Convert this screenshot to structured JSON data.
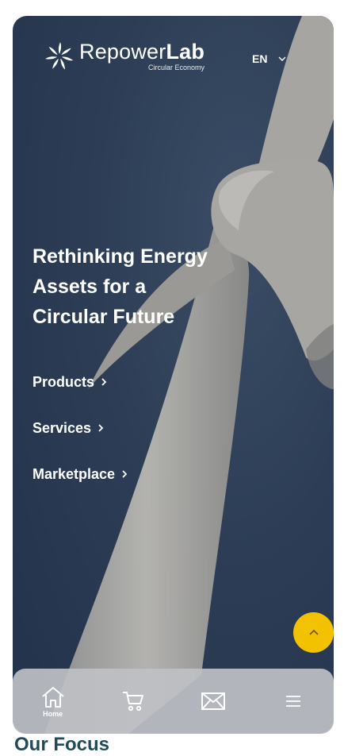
{
  "brand": {
    "name_light": "Repower",
    "name_bold": "Lab",
    "tagline": "Circular Economy"
  },
  "language": {
    "selected": "EN"
  },
  "hero": {
    "headline": "Rethinking Energy Assets for a Circular Future"
  },
  "links": [
    {
      "label": "Products"
    },
    {
      "label": "Services"
    },
    {
      "label": "Marketplace"
    }
  ],
  "tabs": [
    {
      "label": "Home",
      "icon": "home-icon"
    },
    {
      "label": "",
      "icon": "cart-icon"
    },
    {
      "label": "",
      "icon": "mail-icon"
    },
    {
      "label": "",
      "icon": "menu-icon"
    }
  ],
  "section": {
    "title": "Our Focus"
  },
  "colors": {
    "accent": "#f2c200",
    "hero_bg": "#2c3d55",
    "section_title": "#234a57"
  }
}
